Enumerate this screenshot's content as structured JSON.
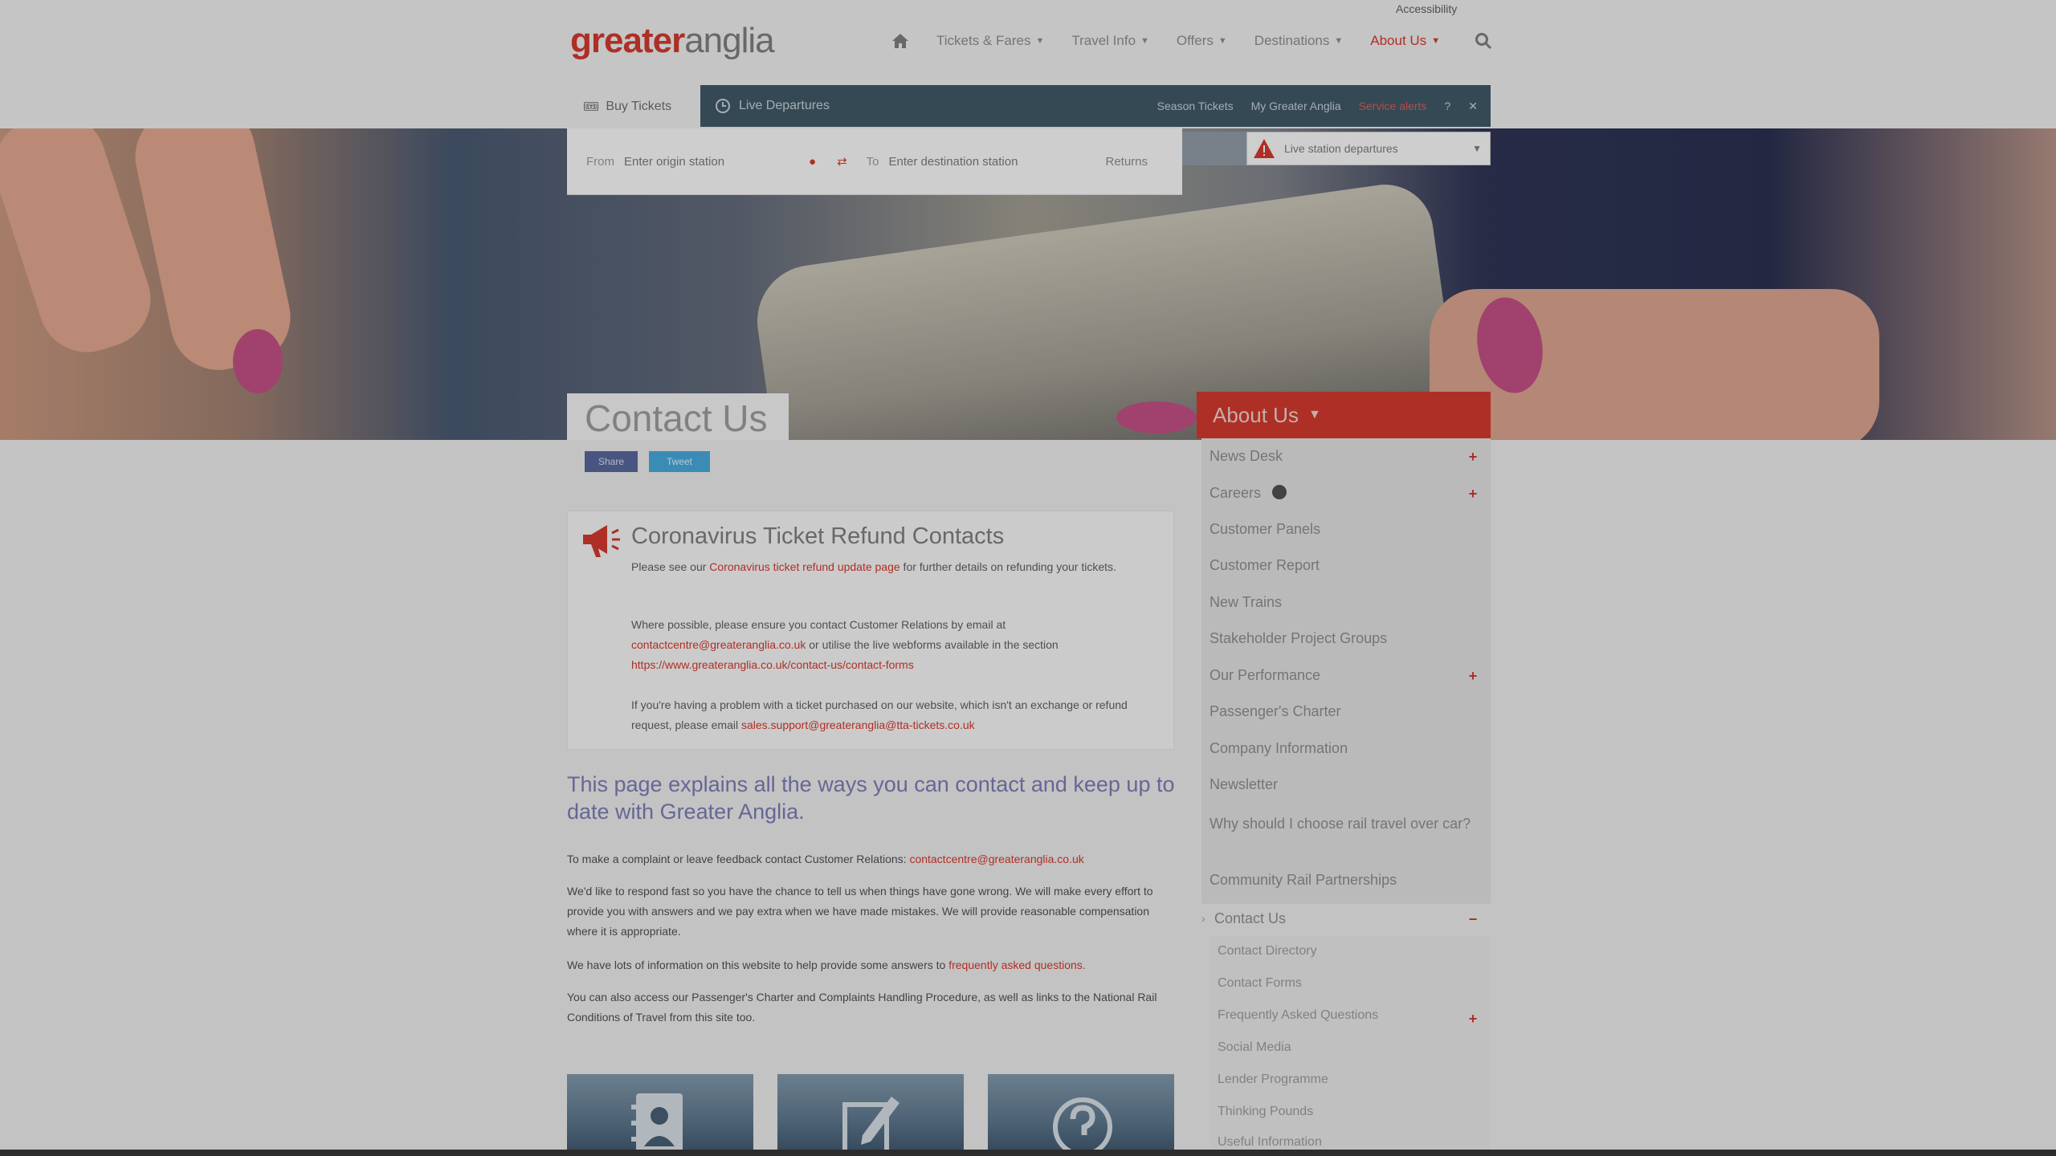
{
  "header": {
    "accessibility": "Accessibility",
    "logo": {
      "part1": "greater",
      "part2": "anglia"
    },
    "nav": [
      {
        "label": "Tickets & Fares",
        "active": false
      },
      {
        "label": "Travel Info",
        "active": false
      },
      {
        "label": "Offers",
        "active": false
      },
      {
        "label": "Destinations",
        "active": false
      },
      {
        "label": "About Us",
        "active": true
      }
    ]
  },
  "ticket_widget": {
    "buy_tab": "Buy Tickets",
    "live_title": "Live Departures",
    "live_links": [
      "Season Tickets",
      "My Greater Anglia",
      "Service alerts"
    ],
    "from_label": "From",
    "from_placeholder": "Enter origin station",
    "to_label": "To",
    "to_placeholder": "Enter destination station",
    "return_label": "Returns",
    "station_search_placeholder": "Live station departures"
  },
  "page": {
    "title": "Contact Us",
    "share": {
      "facebook": "Share",
      "twitter": "Tweet"
    },
    "alert": {
      "title": "Coronavirus Ticket Refund Contacts",
      "p1_text": "Please see our ",
      "p1_link": "Coronavirus ticket refund update page",
      "p1_tail": " for further details on refunding your tickets.",
      "p2_text": "Where possible, please ensure you contact Customer Relations by email at ",
      "p2_link": "contactcentre@greateranglia.co.uk",
      "p2_mid": " or utilise the live webforms available in the section ",
      "p2_link2": "https://www.greateranglia.co.uk/contact-us/contact-forms",
      "p3_text": "If you're having a problem with a ticket purchased on our website, which isn't an exchange or refund request, please email ",
      "p3_link": "sales.support@greateranglia@tta-tickets.co.uk"
    },
    "intro": "This page explains all the ways you can contact and keep up to date with Greater Anglia.",
    "body": [
      {
        "text": "To make a complaint or leave feedback contact Customer Relations: ",
        "link": "contactcentre@greateranglia.co.uk"
      },
      {
        "text": "We'd like to respond fast so you have the chance to tell us when things have gone wrong. We will make every effort to provide you with answers and we pay extra when we have made mistakes. We will provide reasonable compensation where it is appropriate.",
        "link": ""
      },
      {
        "text": "We have lots of information on this website to help provide some answers to ",
        "link": "frequently asked questions."
      },
      {
        "text": "You can also access our Passenger's Charter and Complaints Handling Procedure, as well as links to the National Rail Conditions of Travel from this site too.",
        "link": ""
      }
    ]
  },
  "sidebar": {
    "header": "About Us",
    "items": [
      {
        "label": "News Desk",
        "expandable": true
      },
      {
        "label": "Careers",
        "expandable": true
      },
      {
        "label": "Customer Panels",
        "expandable": false
      },
      {
        "label": "Customer Report",
        "expandable": false
      },
      {
        "label": "New Trains",
        "expandable": false
      },
      {
        "label": "Stakeholder Project Groups",
        "expandable": false
      },
      {
        "label": "Our Performance",
        "expandable": true
      },
      {
        "label": "Passenger's Charter",
        "expandable": false
      },
      {
        "label": "Company Information",
        "expandable": false
      },
      {
        "label": "Newsletter",
        "expandable": false
      },
      {
        "label": "Why should I choose rail travel over car?",
        "expandable": false
      },
      {
        "label": "Community Rail Partnerships",
        "expandable": false
      }
    ],
    "contact": {
      "label": "Contact Us",
      "sub": [
        {
          "label": "Contact Directory",
          "expandable": false
        },
        {
          "label": "Contact Forms",
          "expandable": false
        },
        {
          "label": "Frequently Asked Questions",
          "expandable": true
        },
        {
          "label": "Social Media",
          "expandable": false
        },
        {
          "label": "Lender Programme",
          "expandable": false
        },
        {
          "label": "Thinking Pounds",
          "expandable": false
        },
        {
          "label": "Useful Information",
          "expandable": false
        }
      ]
    }
  },
  "tiles": [
    "contact-directory",
    "contact-forms",
    "faqs"
  ],
  "colors": {
    "brand_red": "#d52b1e",
    "intro_purple": "#7574b5",
    "live_bar": "#334e5e"
  }
}
